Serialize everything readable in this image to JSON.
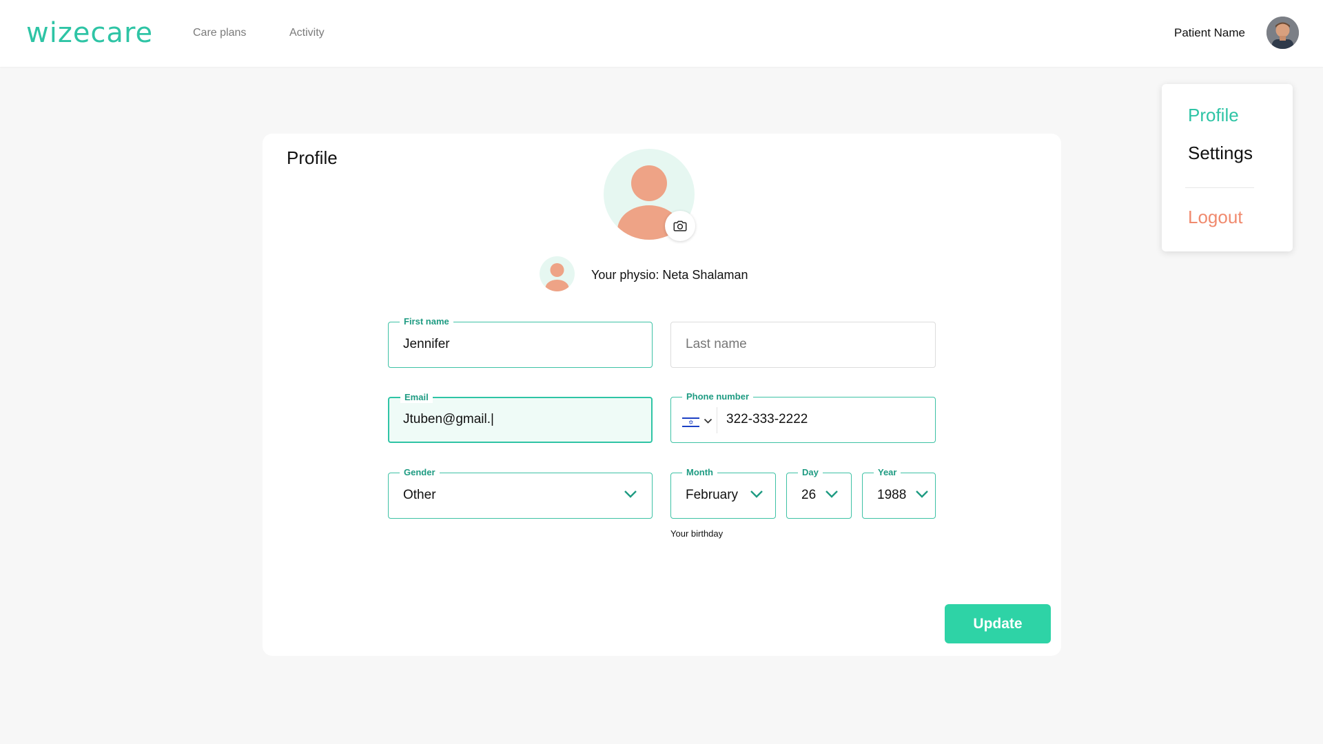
{
  "header": {
    "logo": "wizecare",
    "nav": [
      {
        "label": "Care plans"
      },
      {
        "label": "Activity"
      }
    ],
    "patient_name": "Patient Name"
  },
  "side_menu": {
    "items": [
      {
        "label": "Profile",
        "active": true
      },
      {
        "label": "Settings",
        "active": false
      },
      {
        "label": "Logout",
        "active": false
      }
    ]
  },
  "profile": {
    "title": "Profile",
    "physio_text": "Your physio: Neta Shalaman",
    "fields": {
      "first_name": {
        "label": "First name",
        "value": "Jennifer"
      },
      "last_name": {
        "label": "",
        "placeholder": "Last name"
      },
      "email": {
        "label": "Email",
        "value": "Jtuben@gmail.|"
      },
      "phone": {
        "label": "Phone number",
        "value": "322-333-2222"
      },
      "gender": {
        "label": "Gender",
        "value": "Other"
      },
      "month": {
        "label": "Month",
        "value": "February"
      },
      "day": {
        "label": "Day",
        "value": "26"
      },
      "year": {
        "label": "Year",
        "value": "1988"
      }
    },
    "birthday_helper": "Your birthday",
    "update_label": "Update"
  },
  "colors": {
    "brand": "#2ec4a5",
    "button": "#2ed3a6",
    "logout": "#f08a6e",
    "avatar_person": "#eea386",
    "avatar_bg": "#e6f7f1"
  },
  "icons": [
    "camera-icon",
    "chevron-down-icon",
    "israel-flag-icon",
    "person-icon"
  ]
}
